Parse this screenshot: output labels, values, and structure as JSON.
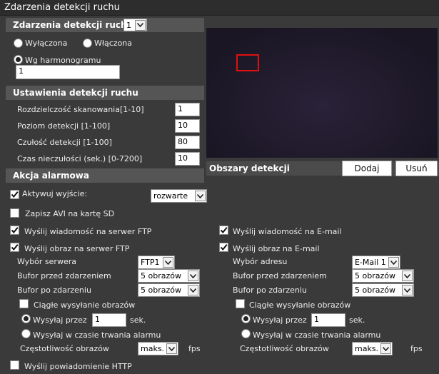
{
  "page_title": "Zdarzenia detekcji ruchu",
  "event_section": {
    "title": "Zdarzenia detekcji ruchu",
    "index_select": "1",
    "radio_off": "Wyłączona",
    "radio_on": "Włączona",
    "radio_schedule": "Wg harmonogramu",
    "schedule_value": "1"
  },
  "settings_section": {
    "title": "Ustawienia detekcji ruchu",
    "rows": [
      {
        "label": "Rozdzielczość skanowania[1-10]",
        "value": "1"
      },
      {
        "label": "Poziom detekcji [1-100]",
        "value": "10"
      },
      {
        "label": "Czułość detekcji [1-100]",
        "value": "80"
      },
      {
        "label": "Czas nieczułości (sek.) [0-7200]",
        "value": "10"
      }
    ]
  },
  "detection_areas": {
    "label": "Obszary detekcji",
    "add_button": "Dodaj",
    "remove_button": "Usuń",
    "rect_color": "#e01010"
  },
  "alarm_section": {
    "title": "Akcja alarmowa",
    "activate_output": "Aktywuj wyjście:",
    "output_select": "rozwarte",
    "save_avi": "Zapisz AVI na kartę SD",
    "ftp_msg": "Wyślij wiadomość na serwer FTP",
    "email_msg": "Wyślij wiadomość na E-mail",
    "ftp_img": "Wyślij obraz na serwer FTP",
    "email_img": "Wyślij obraz na E-mail",
    "http_notify": "Wyślij powiadomienie HTTP"
  },
  "ftp": {
    "server_label": "Wybór serwera",
    "server_value": "FTP1",
    "pre_label": "Bufor przed zdarzeniem",
    "pre_value": "5 obrazów",
    "post_label": "Bufor po zdarzeniu",
    "post_value": "5 obrazów",
    "continuous": "Ciągłe wysyłanie obrazów",
    "send_every": "Wysyłaj przez",
    "send_every_value": "1",
    "sec": "sek.",
    "send_during": "Wysyłaj w czasie trwania alarmu",
    "freq_label": "Częstotliwość obrazów",
    "freq_value": "maks.",
    "fps": "fps"
  },
  "email": {
    "address_label": "Wybór adresu",
    "address_value": "E-Mail 1",
    "pre_label": "Bufor przed zdarzeniem",
    "pre_value": "5 obrazów",
    "post_label": "Bufor po zdarzeniu",
    "post_value": "5 obrazów",
    "continuous": "Ciągłe wysyłanie obrazów",
    "send_every": "Wysyłaj przez",
    "send_every_value": "1",
    "sec": "sek.",
    "send_during": "Wysyłaj w czasie trwania alarmu",
    "freq_label": "Częstotliwość obrazów",
    "freq_value": "maks.",
    "fps": "fps"
  }
}
